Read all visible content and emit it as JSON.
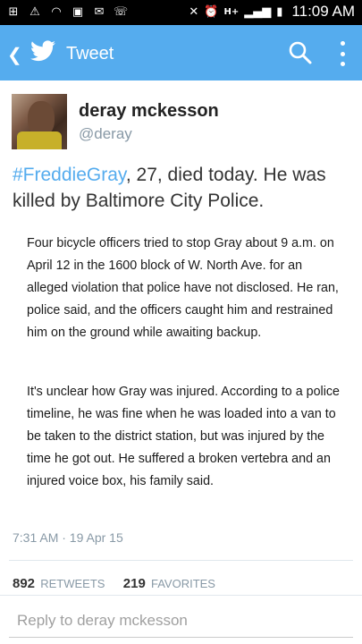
{
  "status_bar": {
    "time": "11:09 AM",
    "network": "H+",
    "icons": [
      "add-box-icon",
      "warning-icon",
      "wifi-icon",
      "image-icon",
      "email-icon",
      "phone-icon",
      "mute-icon",
      "alarm-icon",
      "signal-icon",
      "battery-icon"
    ]
  },
  "app_bar": {
    "title": "Tweet",
    "back_icon": "chevron-left-icon",
    "logo_icon": "twitter-bird-icon",
    "search_icon": "search-icon",
    "more_icon": "more-vertical-icon",
    "color": "#55acee"
  },
  "tweet": {
    "author_name": "deray mckesson",
    "author_handle": "@deray",
    "hashtag": "#FreddieGray",
    "text_rest": ", 27, died today. He was killed by Baltimore City Police.",
    "image_paragraph_1": "Four bicycle officers tried to stop Gray about 9 a.m. on April 12 in the 1600 block of W. North Ave. for an alleged violation that police have not disclosed. He ran, police said, and the officers caught him and restrained him on the ground while awaiting backup.",
    "image_paragraph_2": "It's unclear how Gray was injured. According to a police timeline, he was fine when he was loaded into a van to be taken to the district station, but was injured by the time he got out. He suffered a broken vertebra and an injured voice box, his family said.",
    "timestamp": "7:31 AM · 19 Apr 15",
    "retweets_count": "892",
    "retweets_label": "RETWEETS",
    "favorites_count": "219",
    "favorites_label": "FAVORITES",
    "hashtag_color": "#55acee"
  },
  "reply": {
    "placeholder": "Reply to deray mckesson"
  }
}
